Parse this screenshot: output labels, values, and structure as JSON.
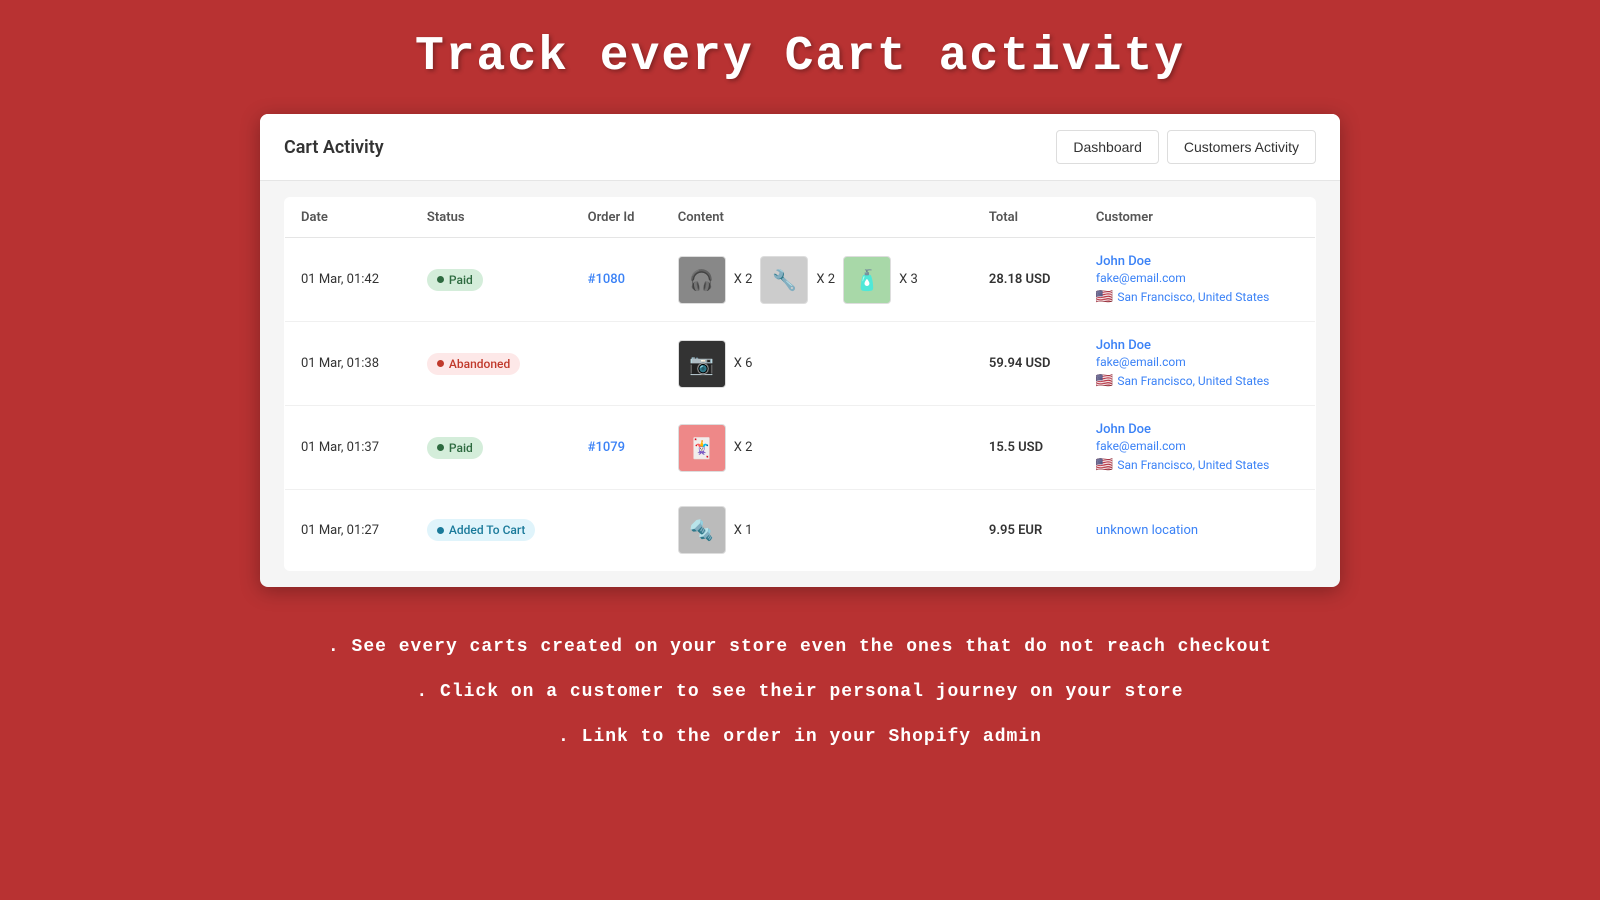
{
  "hero": {
    "title": "Track every Cart activity"
  },
  "app": {
    "title": "Cart Activity",
    "buttons": {
      "dashboard": "Dashboard",
      "customers_activity": "Customers Activity"
    }
  },
  "table": {
    "headers": [
      "Date",
      "Status",
      "Order Id",
      "Content",
      "Total",
      "Customer"
    ],
    "rows": [
      {
        "date": "01 Mar, 01:42",
        "status": "Paid",
        "status_type": "paid",
        "order_id": "#1080",
        "order_id_link": "#1080",
        "products": [
          {
            "icon": "🎧",
            "qty": "X 2",
            "type": "headphone"
          },
          {
            "icon": "🔧",
            "qty": "X 2",
            "type": "pen"
          },
          {
            "icon": "🧴",
            "qty": "X 3",
            "type": "bottle"
          }
        ],
        "total": "28.18 USD",
        "customer_name": "John Doe",
        "customer_email": "fake@email.com",
        "customer_location": "San Francisco, United States",
        "has_location": true
      },
      {
        "date": "01 Mar, 01:38",
        "status": "Abandoned",
        "status_type": "abandoned",
        "order_id": "",
        "products": [
          {
            "icon": "📷",
            "qty": "X 6",
            "type": "camera"
          }
        ],
        "total": "59.94 USD",
        "customer_name": "John Doe",
        "customer_email": "fake@email.com",
        "customer_location": "San Francisco, United States",
        "has_location": true
      },
      {
        "date": "01 Mar, 01:37",
        "status": "Paid",
        "status_type": "paid",
        "order_id": "#1079",
        "products": [
          {
            "icon": "🃏",
            "qty": "X 2",
            "type": "card"
          }
        ],
        "total": "15.5 USD",
        "customer_name": "John Doe",
        "customer_email": "fake@email.com",
        "customer_location": "San Francisco, United States",
        "has_location": true
      },
      {
        "date": "01 Mar, 01:27",
        "status": "Added To Cart",
        "status_type": "added",
        "order_id": "",
        "products": [
          {
            "icon": "🔩",
            "qty": "X 1",
            "type": "screwdriver"
          }
        ],
        "total": "9.95 EUR",
        "customer_name": "",
        "customer_email": "",
        "customer_location": "unknown location",
        "has_location": false
      }
    ]
  },
  "bottom_bullets": [
    ". See every carts created on your store even the ones that do not reach checkout",
    ". Click on a customer to see their personal journey on your store",
    ". Link to the order in your Shopify admin"
  ]
}
